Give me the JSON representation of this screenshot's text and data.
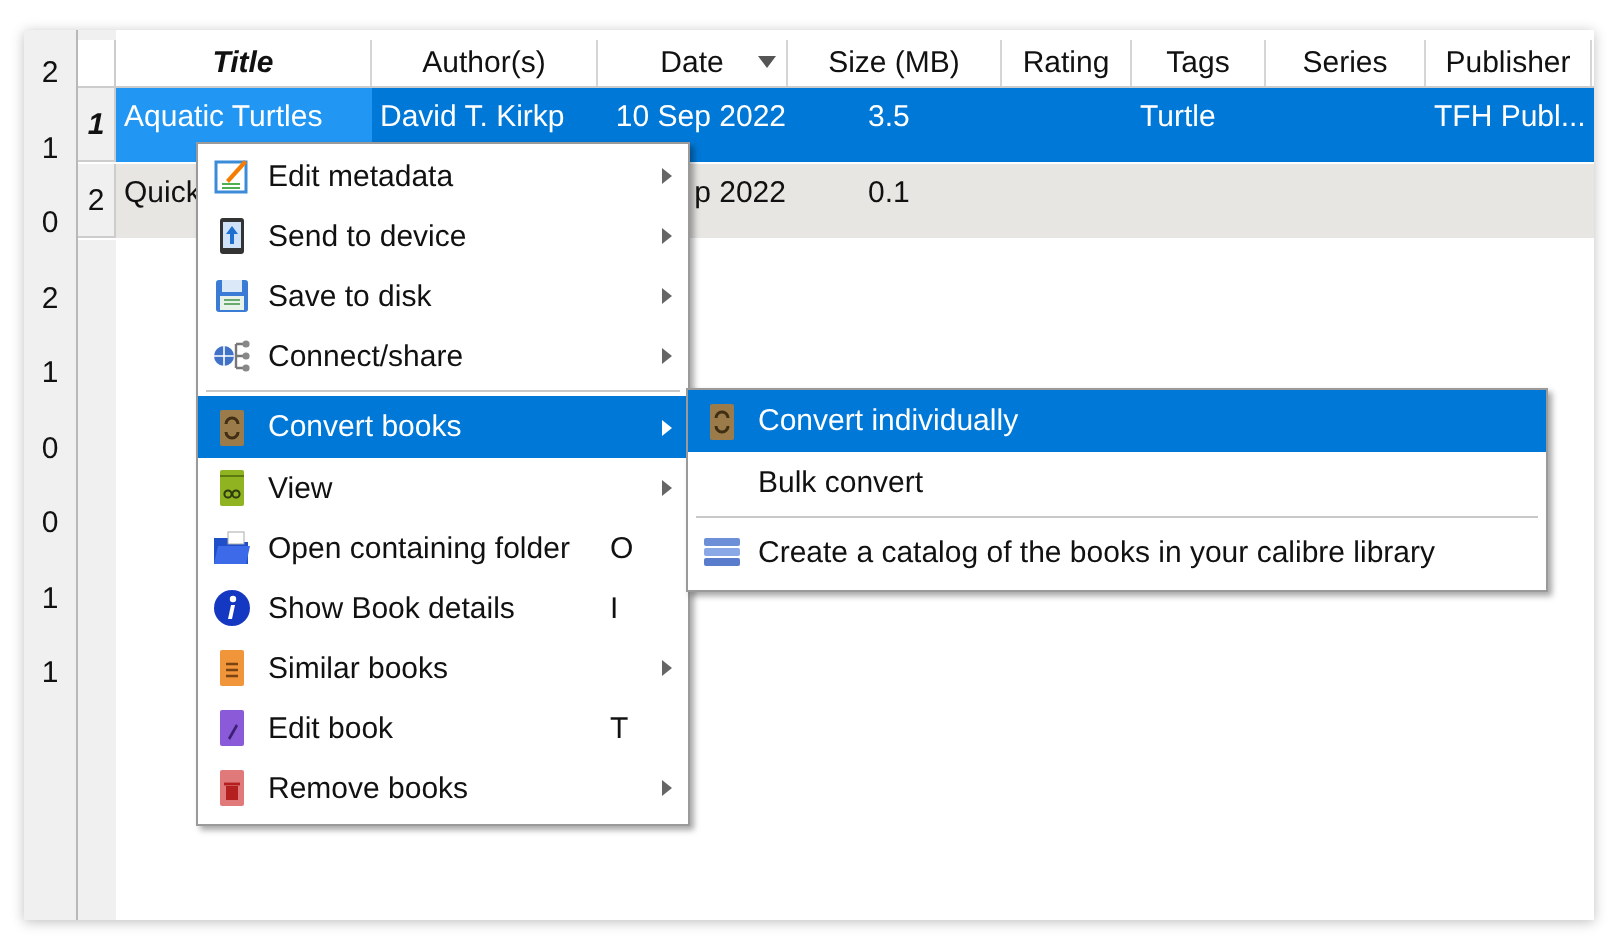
{
  "counts": [
    "2",
    "1",
    "0",
    "2",
    "1",
    "0",
    "0",
    "1",
    "1"
  ],
  "table": {
    "columns": [
      {
        "label": "Title",
        "sorted": false
      },
      {
        "label": "Author(s)",
        "sorted": false
      },
      {
        "label": "Date",
        "sorted": true
      },
      {
        "label": "Size (MB)",
        "sorted": false
      },
      {
        "label": "Rating",
        "sorted": false
      },
      {
        "label": "Tags",
        "sorted": false
      },
      {
        "label": "Series",
        "sorted": false
      },
      {
        "label": "Publisher",
        "sorted": false
      }
    ],
    "rows": [
      {
        "number": "1",
        "selected": true,
        "cells": [
          "Aquatic Turtles",
          "David T. Kirkp",
          "10 Sep 2022",
          "3.5",
          "",
          "Turtle",
          "",
          "TFH Publ..."
        ]
      },
      {
        "number": "2",
        "selected": false,
        "cells": [
          "Quick",
          "",
          "p 2022",
          "0.1",
          "",
          "",
          "",
          ""
        ]
      }
    ]
  },
  "context_menu": {
    "items": [
      {
        "kind": "item",
        "label": "Edit metadata",
        "submenu": true,
        "selected": false
      },
      {
        "kind": "item",
        "label": "Send to device",
        "submenu": true,
        "selected": false
      },
      {
        "kind": "item",
        "label": "Save to disk",
        "submenu": true,
        "selected": false
      },
      {
        "kind": "item",
        "label": "Connect/share",
        "submenu": true,
        "selected": false
      },
      {
        "kind": "separator"
      },
      {
        "kind": "item",
        "label": "Convert books",
        "submenu": true,
        "selected": true
      },
      {
        "kind": "item",
        "label": "View",
        "submenu": true,
        "selected": false
      },
      {
        "kind": "item",
        "label": "Open containing folder",
        "shortcut": "O",
        "submenu": false,
        "selected": false
      },
      {
        "kind": "item",
        "label": "Show Book details",
        "shortcut": "I",
        "submenu": false,
        "selected": false
      },
      {
        "kind": "item",
        "label": "Similar books",
        "submenu": true,
        "selected": false
      },
      {
        "kind": "item",
        "label": "Edit book",
        "shortcut": "T",
        "submenu": false,
        "selected": false
      },
      {
        "kind": "item",
        "label": "Remove books",
        "submenu": true,
        "selected": false
      }
    ]
  },
  "submenu": {
    "items": [
      {
        "kind": "item",
        "label": "Convert individually",
        "icon": true,
        "selected": true
      },
      {
        "kind": "item",
        "label": "Bulk convert",
        "icon": false,
        "selected": false
      },
      {
        "kind": "separator"
      },
      {
        "kind": "item",
        "label": "Create a catalog of the books in your calibre library",
        "icon": true,
        "selected": false
      }
    ]
  }
}
